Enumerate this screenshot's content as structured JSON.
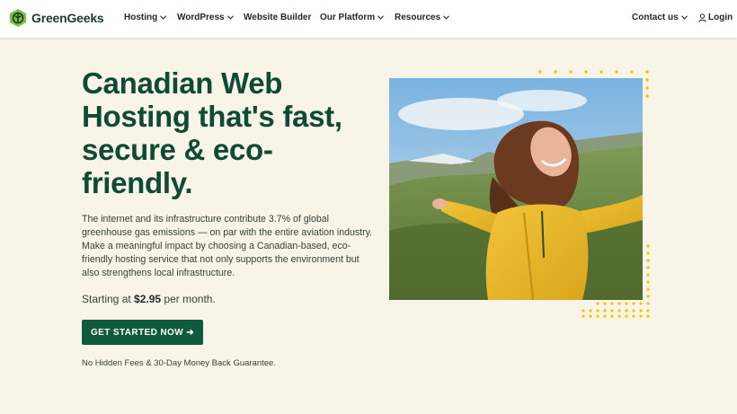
{
  "brand": {
    "name": "GreenGeeks"
  },
  "nav": {
    "hosting": "Hosting",
    "wordpress": "WordPress",
    "website_builder": "Website Builder",
    "our_platform": "Our Platform",
    "resources": "Resources",
    "contact": "Contact us",
    "login": "Login"
  },
  "hero": {
    "title": "Canadian Web Hosting that's fast, secure & eco-friendly.",
    "description": "The internet and its infrastructure contribute 3.7% of global greenhouse gas emissions — on par with the entire aviation industry. Make a meaningful impact by choosing a Canadian-based, eco-friendly hosting service that not only supports the environment but also strengthens local infrastructure.",
    "price_prefix": "Starting at",
    "price": "$2.95",
    "price_suffix": "per month.",
    "cta": "GET STARTED NOW ➔",
    "guarantee": "No Hidden Fees & 30-Day Money Back Guarantee."
  },
  "colors": {
    "brand_green": "#0f4b34",
    "button_green": "#0e5a3a",
    "accent_yellow": "#f5c400",
    "background": "#f8f4e8"
  },
  "icons": [
    "greengeeks-logo-icon",
    "chevron-down-icon",
    "user-icon",
    "arrow-right-icon"
  ]
}
